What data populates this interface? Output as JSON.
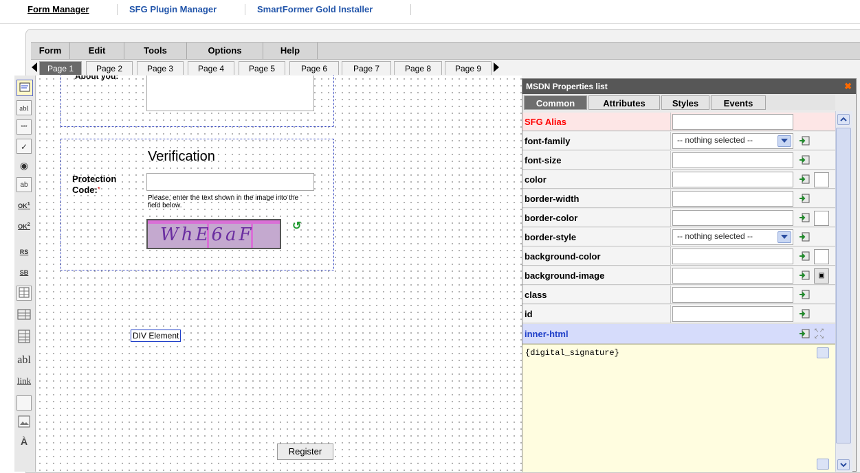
{
  "top_tabs": [
    "Form Manager",
    "SFG Plugin Manager",
    "SmartFormer Gold Installer"
  ],
  "menu": [
    "Form",
    "Edit",
    "Tools",
    "Options",
    "Help"
  ],
  "pages": [
    "Page 1",
    "Page 2",
    "Page 3",
    "Page 4",
    "Page 5",
    "Page 6",
    "Page 7",
    "Page 8",
    "Page 9"
  ],
  "toolbar": {
    "icons": [
      "select-tool-icon",
      "textbox-tool-icon",
      "password-tool-icon",
      "checkbox-tool-icon",
      "radio-tool-icon",
      "listbox-tool-icon",
      "option-tool-icon",
      "option2-tool-icon",
      "radio-set-tool-icon",
      "select-set-tool-icon",
      "grid-tool-icon",
      "table-tool-icon",
      "table2-tool-icon",
      "text-tool-icon",
      "link-tool-icon",
      "div-tool-icon",
      "image-tool-icon",
      "spell-tool-icon"
    ],
    "labels": {
      "textbox": "abl",
      "password": "***",
      "ok1": "OK",
      "ok1_sup": "1",
      "ok2": "OK",
      "ok2_sup": "2",
      "rs": "RS",
      "sb": "SB",
      "text": "abl",
      "link": "link"
    }
  },
  "form": {
    "about_label": "About you:",
    "verification_title": "Verification",
    "protection_label": "Protection Code:",
    "required_mark": "*",
    "captcha_hint": "Please, enter the text shown in the image into the field below.",
    "captcha_text": "WhE6aF",
    "div_element": "DIV Element",
    "register_button": "Register"
  },
  "panel": {
    "title": "MSDN Properties list",
    "tabs": [
      "Common",
      "Attributes",
      "Styles",
      "Events"
    ],
    "active_tab": "Common",
    "alias_label": "SFG Alias",
    "properties": [
      {
        "label": "font-family",
        "value": "-- nothing selected --",
        "type": "select"
      },
      {
        "label": "font-size",
        "value": "",
        "type": "text"
      },
      {
        "label": "color",
        "value": "",
        "type": "color"
      },
      {
        "label": "border-width",
        "value": "",
        "type": "text"
      },
      {
        "label": "border-color",
        "value": "",
        "type": "color"
      },
      {
        "label": "border-style",
        "value": "-- nothing selected --",
        "type": "select"
      },
      {
        "label": "background-color",
        "value": "",
        "type": "color"
      },
      {
        "label": "background-image",
        "value": "",
        "type": "image"
      },
      {
        "label": "class",
        "value": "",
        "type": "text"
      },
      {
        "label": "id",
        "value": "",
        "type": "text"
      }
    ],
    "inner_html_label": "inner-html",
    "inner_html_value": "{digital_signature}"
  },
  "colors": {
    "alias_red": "#ff0000",
    "inner_html_blue": "#1f3fc8",
    "panel_title_bg": "#575757",
    "active_tab_bg": "#6e6e6e"
  }
}
